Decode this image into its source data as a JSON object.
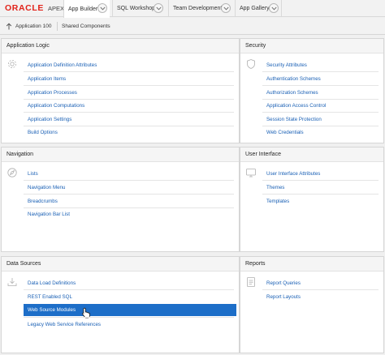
{
  "header": {
    "logo_brand": "ORACLE",
    "logo_product": "APEX",
    "tabs": [
      {
        "label": "App Builder",
        "active": true
      },
      {
        "label": "SQL Workshop",
        "active": false
      },
      {
        "label": "Team Development",
        "active": false
      },
      {
        "label": "App Gallery",
        "active": false
      }
    ]
  },
  "breadcrumb": {
    "items": [
      "Application 100",
      "Shared Components"
    ]
  },
  "sections": {
    "application_logic": {
      "title": "Application Logic",
      "icon": "gear-icon",
      "links": [
        "Application Definition Attributes",
        "Application Items",
        "Application Processes",
        "Application Computations",
        "Application Settings",
        "Build Options"
      ]
    },
    "security": {
      "title": "Security",
      "icon": "shield-icon",
      "links": [
        "Security Attributes",
        "Authentication Schemes",
        "Authorization Schemes",
        "Application Access Control",
        "Session State Protection",
        "Web Credentials"
      ]
    },
    "navigation": {
      "title": "Navigation",
      "icon": "compass-icon",
      "links": [
        "Lists",
        "Navigation Menu",
        "Breadcrumbs",
        "Navigation Bar List"
      ]
    },
    "user_interface": {
      "title": "User Interface",
      "icon": "monitor-icon",
      "links": [
        "User Interface Attributes",
        "Themes",
        "Templates"
      ]
    },
    "data_sources": {
      "title": "Data Sources",
      "icon": "download-icon",
      "links": [
        "Data Load Definitions",
        "REST Enabled SQL",
        "Web Source Modules",
        "Legacy Web Service References"
      ],
      "highlighted_link": "Web Source Modules"
    },
    "reports": {
      "title": "Reports",
      "icon": "report-icon",
      "links": [
        "Report Queries",
        "Report Layouts"
      ]
    }
  },
  "colors": {
    "link": "#1a60b5",
    "highlight": "#1d6ec8",
    "oracle_red": "#e2231a"
  }
}
